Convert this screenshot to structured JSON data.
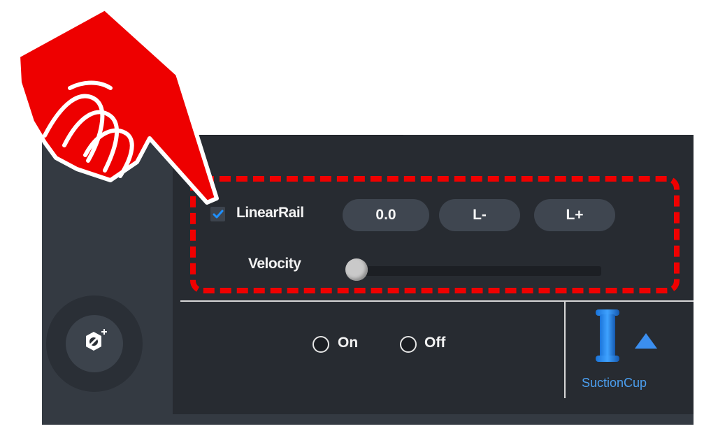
{
  "linear_rail": {
    "label": "LinearRail",
    "enabled": true,
    "value": "0.0",
    "minus_label": "L-",
    "plus_label": "L+"
  },
  "velocity": {
    "label": "Velocity",
    "level": 0.0
  },
  "output": {
    "on_label": "On",
    "off_label": "Off",
    "selected": null
  },
  "tool": {
    "name": "SuctionCup",
    "icon": "suction-cup-icon"
  },
  "colors": {
    "accent": "#1e90ff",
    "highlight": "#f00000",
    "panel": "#272b31"
  }
}
